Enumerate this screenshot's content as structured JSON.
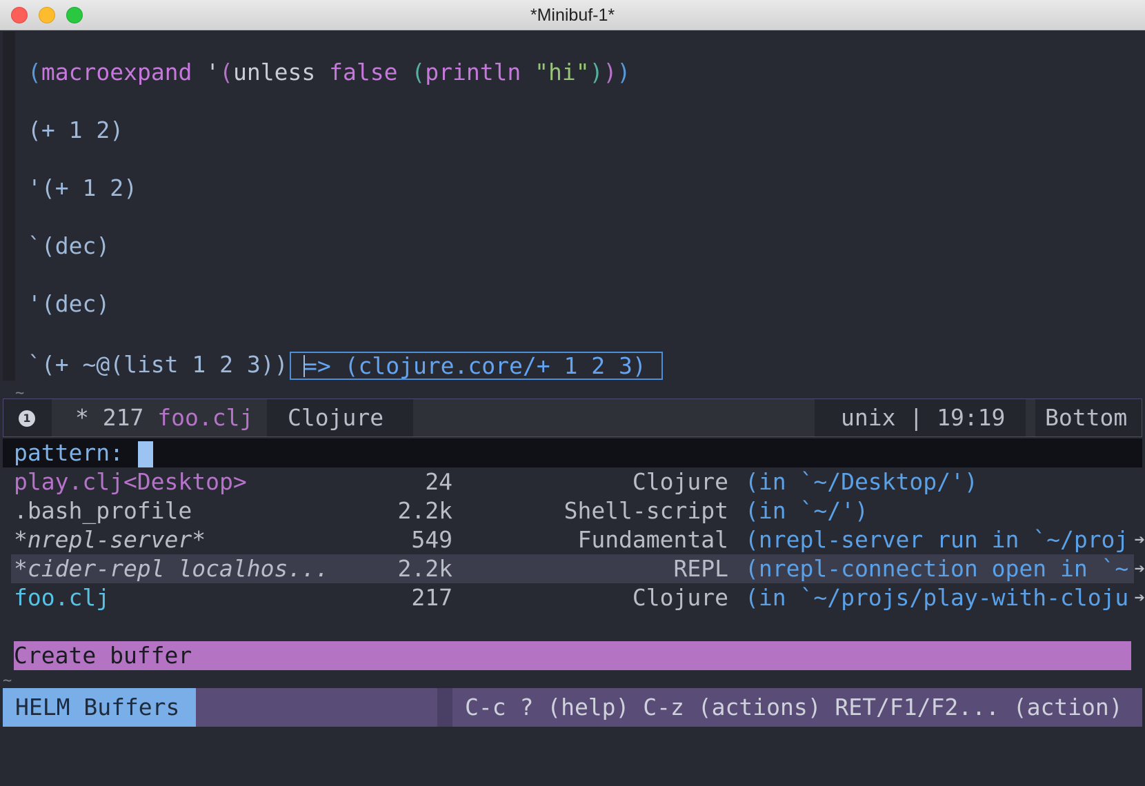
{
  "window": {
    "title": "*Minibuf-1*"
  },
  "buffer": {
    "lines": [
      {
        "t1": "(",
        "t2": "macroexpand",
        "t3": " '",
        "t4": "(",
        "t5": "unless ",
        "t6": "false",
        "t7": " ",
        "t8": "(",
        "t9": "println",
        "t10": " ",
        "t11": "\"hi\"",
        "t12": ")",
        "t13": ")",
        "t14": ")"
      },
      {
        "text": "(+ 1 2)"
      },
      {
        "text": "'(+ 1 2)"
      },
      {
        "text": "`(dec)"
      },
      {
        "text": "'(dec)"
      },
      {
        "text": "`(+ ~@(list 1 2 3))"
      }
    ],
    "eval_result": "=> (clojure.core/+ 1 2 3)"
  },
  "modeline": {
    "window_number": "1",
    "modified": "*",
    "size": "217",
    "filename": "foo.clj",
    "major_mode": "Clojure",
    "encoding": "unix | 19:19",
    "position": "Bottom"
  },
  "minibuffer": {
    "prompt": "pattern:"
  },
  "buffers": [
    {
      "name": "play.clj<Desktop>",
      "size": "24",
      "mode": "Clojure",
      "location": "(in `~/Desktop/')",
      "style": "purple",
      "truncated": false
    },
    {
      "name": ".bash_profile",
      "size": "2.2k",
      "mode": "Shell-script",
      "location": "(in `~/')",
      "style": "grey",
      "truncated": false
    },
    {
      "name": "*nrepl-server*",
      "size": "549",
      "mode": "Fundamental",
      "location": "(nrepl-server run in `~/proj",
      "style": "italic",
      "truncated": true
    },
    {
      "name": "*cider-repl localhos...",
      "size": "2.2k",
      "mode": "REPL",
      "location": "(nrepl-connection open in `~",
      "style": "italic",
      "truncated": true,
      "selected": true
    },
    {
      "name": "foo.clj",
      "size": "217",
      "mode": "Clojure",
      "location": "(in `~/projs/play-with-cloju",
      "style": "cyan",
      "truncated": true
    }
  ],
  "source_header": "Create buffer",
  "helm": {
    "name": "HELM Buffers",
    "help": "C-c ? (help) C-z (actions) RET/F1/F2... (action)"
  }
}
